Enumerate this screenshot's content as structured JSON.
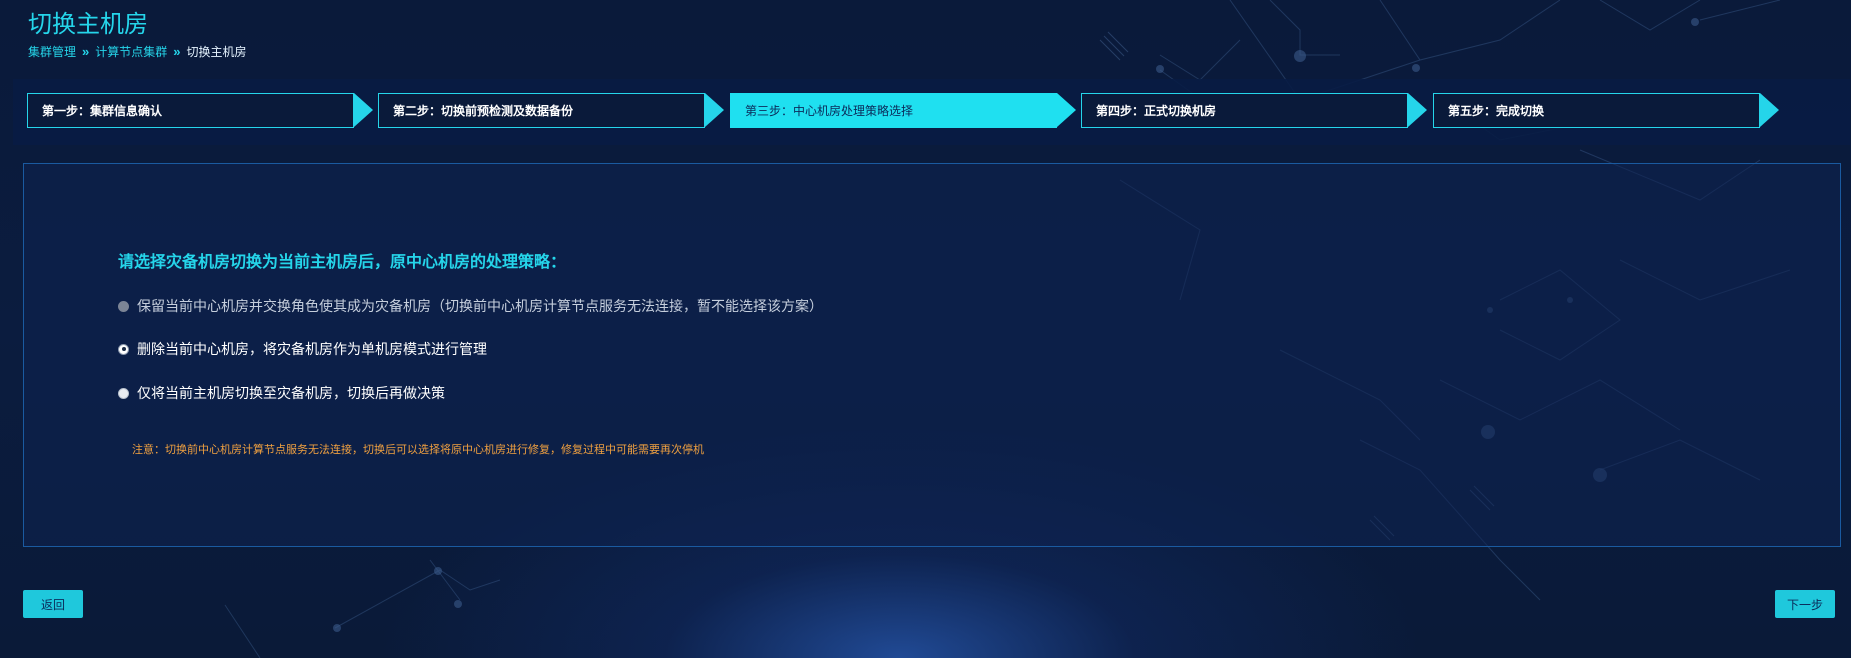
{
  "page": {
    "title": "切换主机房"
  },
  "breadcrumb": {
    "items": [
      "集群管理",
      "计算节点集群"
    ],
    "separator": "»",
    "current": "切换主机房"
  },
  "steps": [
    {
      "label": "第一步：集群信息确认",
      "active": false
    },
    {
      "label": "第二步：切换前预检测及数据备份",
      "active": false
    },
    {
      "label": "第三步：中心机房处理策略选择",
      "active": true
    },
    {
      "label": "第四步：正式切换机房",
      "active": false
    },
    {
      "label": "第五步：完成切换",
      "active": false
    }
  ],
  "panel": {
    "question": "请选择灾备机房切换为当前主机房后，原中心机房的处理策略：",
    "options": [
      {
        "label": "保留当前中心机房并交换角色使其成为灾备机房（切换前中心机房计算节点服务无法连接，暂不能选择该方案）",
        "state": "disabled"
      },
      {
        "label": "删除当前中心机房，将灾备机房作为单机房模式进行管理",
        "state": "checked"
      },
      {
        "label": "仅将当前主机房切换至灾备机房，切换后再做决策",
        "state": "unchecked"
      }
    ],
    "note": "注意：切换前中心机房计算节点服务无法连接，切换后可以选择将原中心机房进行修复，修复过程中可能需要再次停机"
  },
  "buttons": {
    "back": "返回",
    "next": "下一步"
  },
  "colors": {
    "accent": "#25d5ea",
    "active_step": "#1fe0f0",
    "note": "#f0a040",
    "button": "#1fc8dc"
  }
}
